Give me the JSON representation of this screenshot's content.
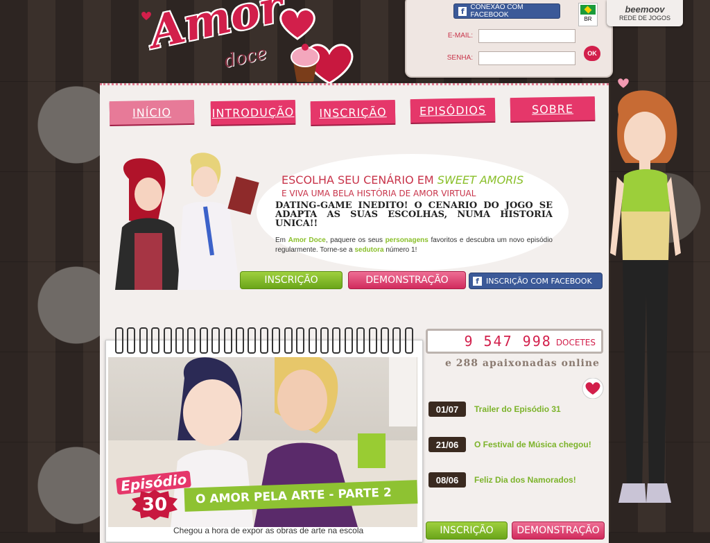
{
  "logo": {
    "word1": "Amor",
    "word2": "doce"
  },
  "login": {
    "facebook_label": "CONEXÃO COM FACEBOOK",
    "country": "BR",
    "email_label": "E-MAIL:",
    "password_label": "SENHA:",
    "ok_label": "OK"
  },
  "network": {
    "brand": "beemoov",
    "label": "REDE DE JOGOS"
  },
  "nav": {
    "tabs": [
      {
        "label": "INÍCIO"
      },
      {
        "label": "INTRODUÇÃO"
      },
      {
        "label": "INSCRIÇÃO"
      },
      {
        "label": "EPISÓDIOS"
      },
      {
        "label": "SOBRE"
      }
    ]
  },
  "hero": {
    "title_prefix": "ESCOLHA SEU CENÁRIO EM ",
    "title_highlight": "SWEET AMORIS",
    "subtitle": "E VIVA UMA BELA HISTÓRIA DE AMOR VIRTUAL",
    "bold_text": "DATING-GAME INEDITO! O CENARIO DO JOGO SE ADAPTA AS SUAS ESCOLHAS, NUMA HISTORIA UNICA!!",
    "desc_1": "Em ",
    "desc_brand": "Amor Doce",
    "desc_2": ", paquere os seus ",
    "desc_link": "personagens",
    "desc_3": " favoritos e descubra um novo episódio regularmente. Torne-se a ",
    "desc_link2": "sedutora",
    "desc_4": " número 1!",
    "btn_signup": "INSCRIÇÃO",
    "btn_demo": "DEMONSTRAÇÃO",
    "btn_fb": "INSCRIÇÃO COM FACEBOOK"
  },
  "episode": {
    "word": "Episódio",
    "number": "30",
    "title": "O AMOR PELA ARTE - PARTE 2",
    "text": "Chegou a hora de expor as obras de arte na escola"
  },
  "stats": {
    "count": "9 547 998",
    "unit": "DOCETES",
    "online": "e 288 apaixonadas online"
  },
  "news": [
    {
      "date": "01/07",
      "title": "Trailer do Episódio 31"
    },
    {
      "date": "21/06",
      "title": "O Festival de Música chegou!"
    },
    {
      "date": "08/06",
      "title": "Feliz Dia dos Namorados!"
    }
  ],
  "bottom": {
    "btn_signup": "INSCRIÇÃO",
    "btn_demo": "DEMONSTRAÇÃO"
  }
}
